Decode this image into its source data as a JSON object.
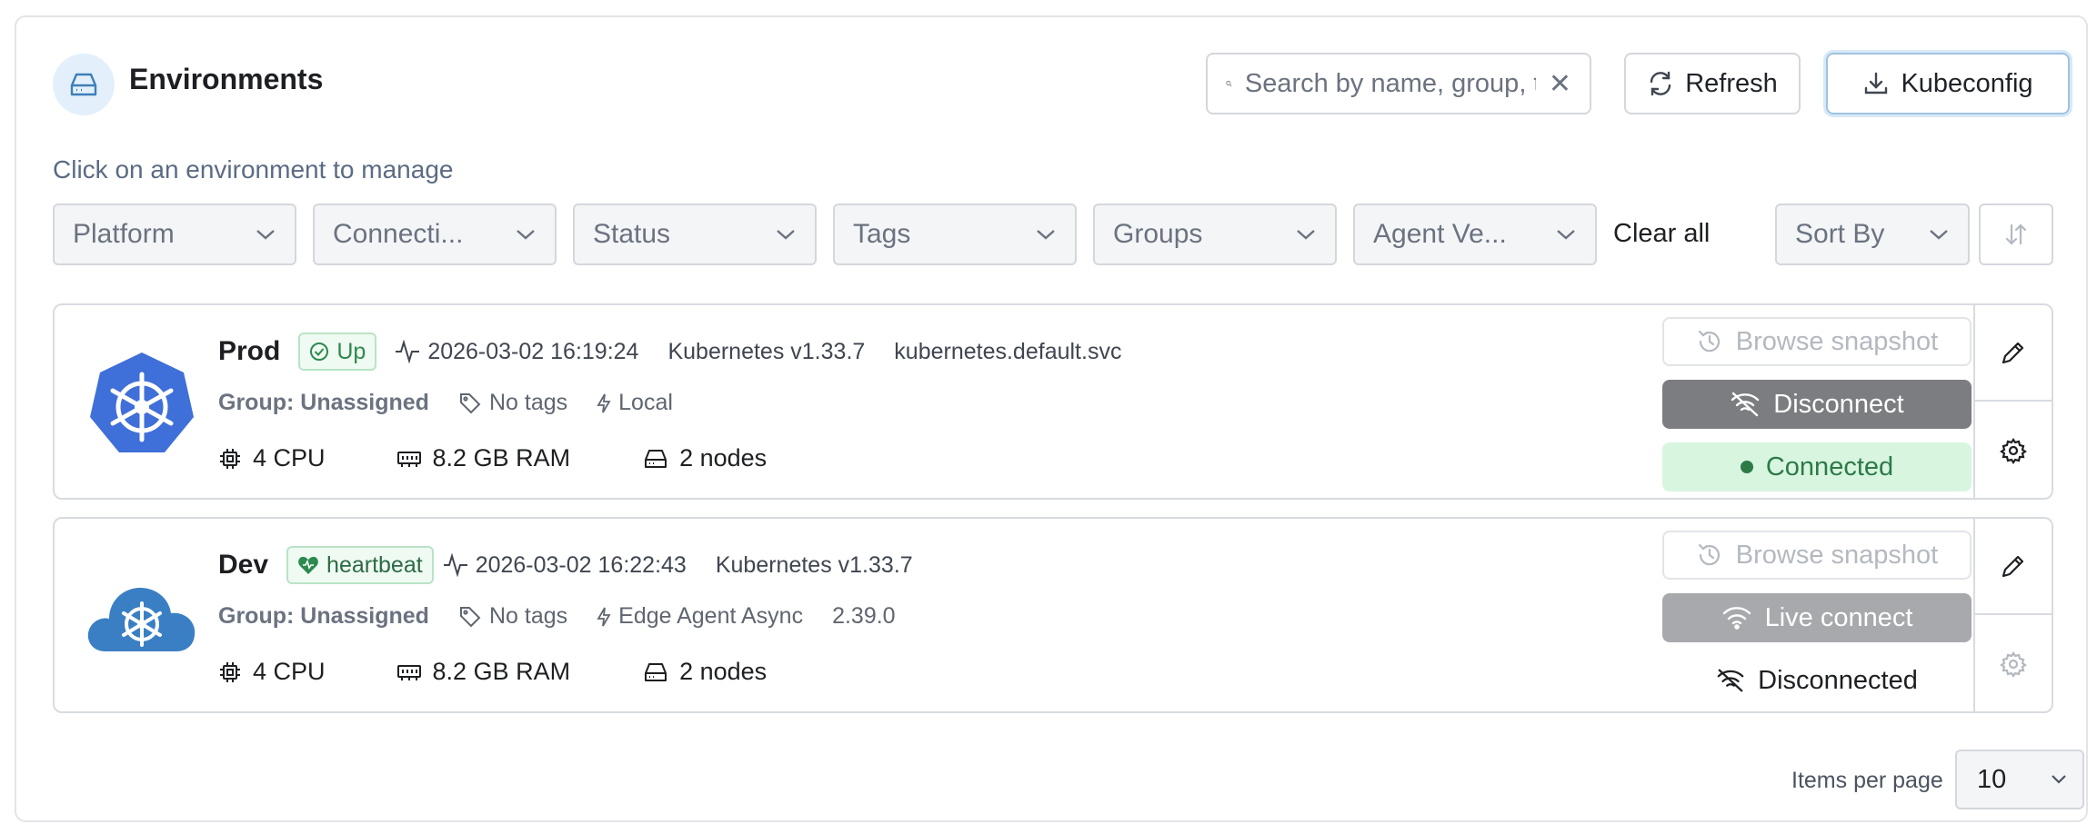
{
  "header": {
    "title": "Environments",
    "icon": "server-icon",
    "search_placeholder": "Search by name, group, tag, status, URL...",
    "refresh_label": "Refresh",
    "kubeconfig_label": "Kubeconfig"
  },
  "subtitle": "Click on an environment to manage",
  "filters": [
    {
      "label": "Platform"
    },
    {
      "label": "Connecti..."
    },
    {
      "label": "Status"
    },
    {
      "label": "Tags"
    },
    {
      "label": "Groups"
    },
    {
      "label": "Agent Ve..."
    }
  ],
  "clear_all_label": "Clear all",
  "sort_by_label": "Sort By",
  "environments": [
    {
      "name": "Prod",
      "status_badge": "Up",
      "heartbeat_time": "2026-03-02 16:19:24",
      "platform_version": "Kubernetes v1.33.7",
      "url": "kubernetes.default.svc",
      "group": "Group: Unassigned",
      "tags": "No tags",
      "connection_type": "Local",
      "agent_version": "",
      "cpu": "4 CPU",
      "ram": "8.2 GB RAM",
      "nodes": "2 nodes",
      "actions": {
        "snapshot": "Browse snapshot",
        "primary": "Disconnect",
        "status": "Connected"
      }
    },
    {
      "name": "Dev",
      "status_badge": "heartbeat",
      "heartbeat_time": "2026-03-02 16:22:43",
      "platform_version": "Kubernetes v1.33.7",
      "url": "",
      "group": "Group: Unassigned",
      "tags": "No tags",
      "connection_type": "Edge Agent Async",
      "agent_version": "2.39.0",
      "cpu": "4 CPU",
      "ram": "8.2 GB RAM",
      "nodes": "2 nodes",
      "actions": {
        "snapshot": "Browse snapshot",
        "primary": "Live connect",
        "status": "Disconnected"
      }
    }
  ],
  "pagination": {
    "label": "Items per page",
    "value": "10"
  },
  "colors": {
    "accent": "#3c6ed8",
    "connected_bg": "#d8f5e0",
    "connected_text": "#2d7a47",
    "disconnect_bg": "#7b7d80",
    "live_bg": "#a7a9ac"
  }
}
